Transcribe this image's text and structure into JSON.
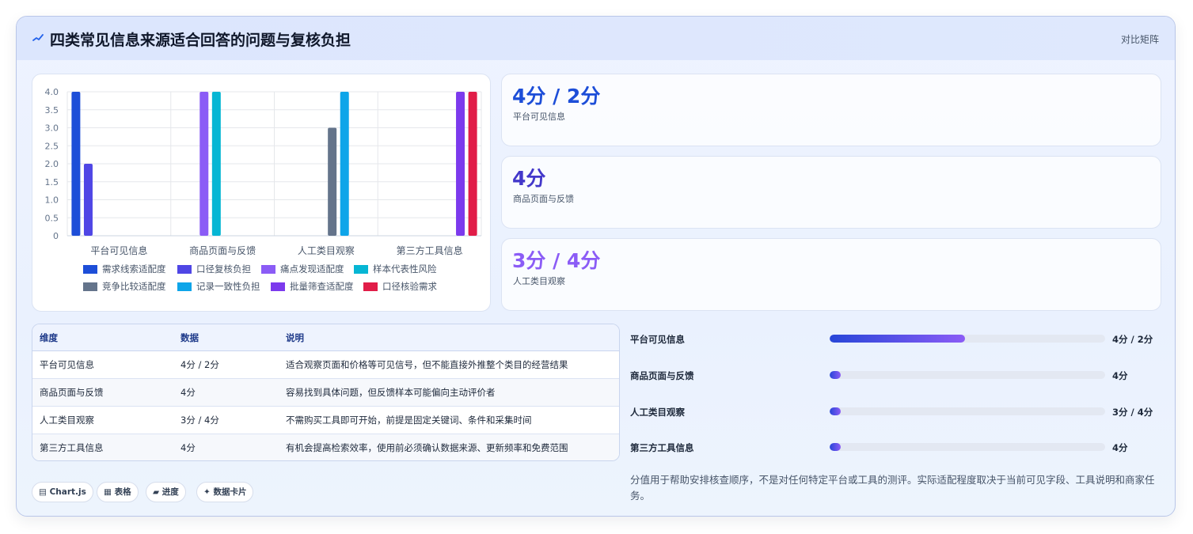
{
  "header": {
    "icon": "sparkline-icon",
    "title": "四类常见信息来源适合回答的问题与复核负担",
    "tag": "对比矩阵"
  },
  "chart_data": {
    "type": "bar",
    "categories": [
      "平台可见信息",
      "商品页面与反馈",
      "人工类目观察",
      "第三方工具信息"
    ],
    "ylim": [
      0,
      4
    ],
    "yticks": [
      "0",
      "0.5",
      "1.0",
      "1.5",
      "2.0",
      "2.5",
      "3.0",
      "3.5",
      "4.0"
    ],
    "series": [
      {
        "name": "需求线索适配度",
        "color": "#1d4ed8",
        "values": [
          4,
          null,
          null,
          null
        ]
      },
      {
        "name": "口径复核负担",
        "color": "#4f46e5",
        "values": [
          2,
          null,
          null,
          null
        ]
      },
      {
        "name": "痛点发现适配度",
        "color": "#8b5cf6",
        "values": [
          null,
          4,
          null,
          null
        ]
      },
      {
        "name": "样本代表性风险",
        "color": "#06b6d4",
        "values": [
          null,
          4,
          null,
          null
        ]
      },
      {
        "name": "竞争比较适配度",
        "color": "#64748b",
        "values": [
          null,
          null,
          3,
          null
        ]
      },
      {
        "name": "记录一致性负担",
        "color": "#0ea5e9",
        "values": [
          null,
          null,
          4,
          null
        ]
      },
      {
        "name": "批量筛查适配度",
        "color": "#7c3aed",
        "values": [
          null,
          null,
          null,
          4
        ]
      },
      {
        "name": "口径核验需求",
        "color": "#e11d48",
        "values": [
          null,
          null,
          null,
          4
        ]
      }
    ],
    "grid": true,
    "legend": "bottom"
  },
  "stats": [
    {
      "value": "4分 / 2分",
      "label": "平台可见信息",
      "color": "#1d4ed8"
    },
    {
      "value": "4分",
      "label": "商品页面与反馈",
      "color": "#4338ca"
    },
    {
      "value": "3分 / 4分",
      "label": "人工类目观察",
      "color": "#8b5cf6"
    }
  ],
  "table": {
    "headers": [
      "维度",
      "数据",
      "说明"
    ],
    "rows": [
      {
        "dim": "平台可见信息",
        "data": "4分 / 2分",
        "desc": "适合观察页面和价格等可见信号，但不能直接外推整个类目的经营结果"
      },
      {
        "dim": "商品页面与反馈",
        "data": "4分",
        "desc": "容易找到具体问题，但反馈样本可能偏向主动评价者"
      },
      {
        "dim": "人工类目观察",
        "data": "3分 / 4分",
        "desc": "不需购买工具即可开始，前提是固定关键词、条件和采集时间"
      },
      {
        "dim": "第三方工具信息",
        "data": "4分",
        "desc": "有机会提高检索效率，使用前必须确认数据来源、更新频率和免费范围"
      }
    ]
  },
  "chips": [
    {
      "icon": "chart-icon",
      "glyph": "▤",
      "label": "Chart.js"
    },
    {
      "icon": "table-icon",
      "glyph": "▦",
      "label": "表格"
    },
    {
      "icon": "progress-icon",
      "glyph": "▰",
      "label": "进度"
    },
    {
      "icon": "sparkle-icon",
      "glyph": "✦",
      "label": "数据卡片"
    }
  ],
  "progress": [
    {
      "label": "平台可见信息",
      "value": "4分 / 2分",
      "fraction": 0.49
    },
    {
      "label": "商品页面与反馈",
      "value": "4分",
      "fraction": 0.04
    },
    {
      "label": "人工类目观察",
      "value": "3分 / 4分",
      "fraction": 0.04
    },
    {
      "label": "第三方工具信息",
      "value": "4分",
      "fraction": 0.04
    }
  ],
  "note": "分值用于帮助安排核查顺序，不是对任何特定平台或工具的测评。实际适配程度取决于当前可见字段、工具说明和商家任务。"
}
